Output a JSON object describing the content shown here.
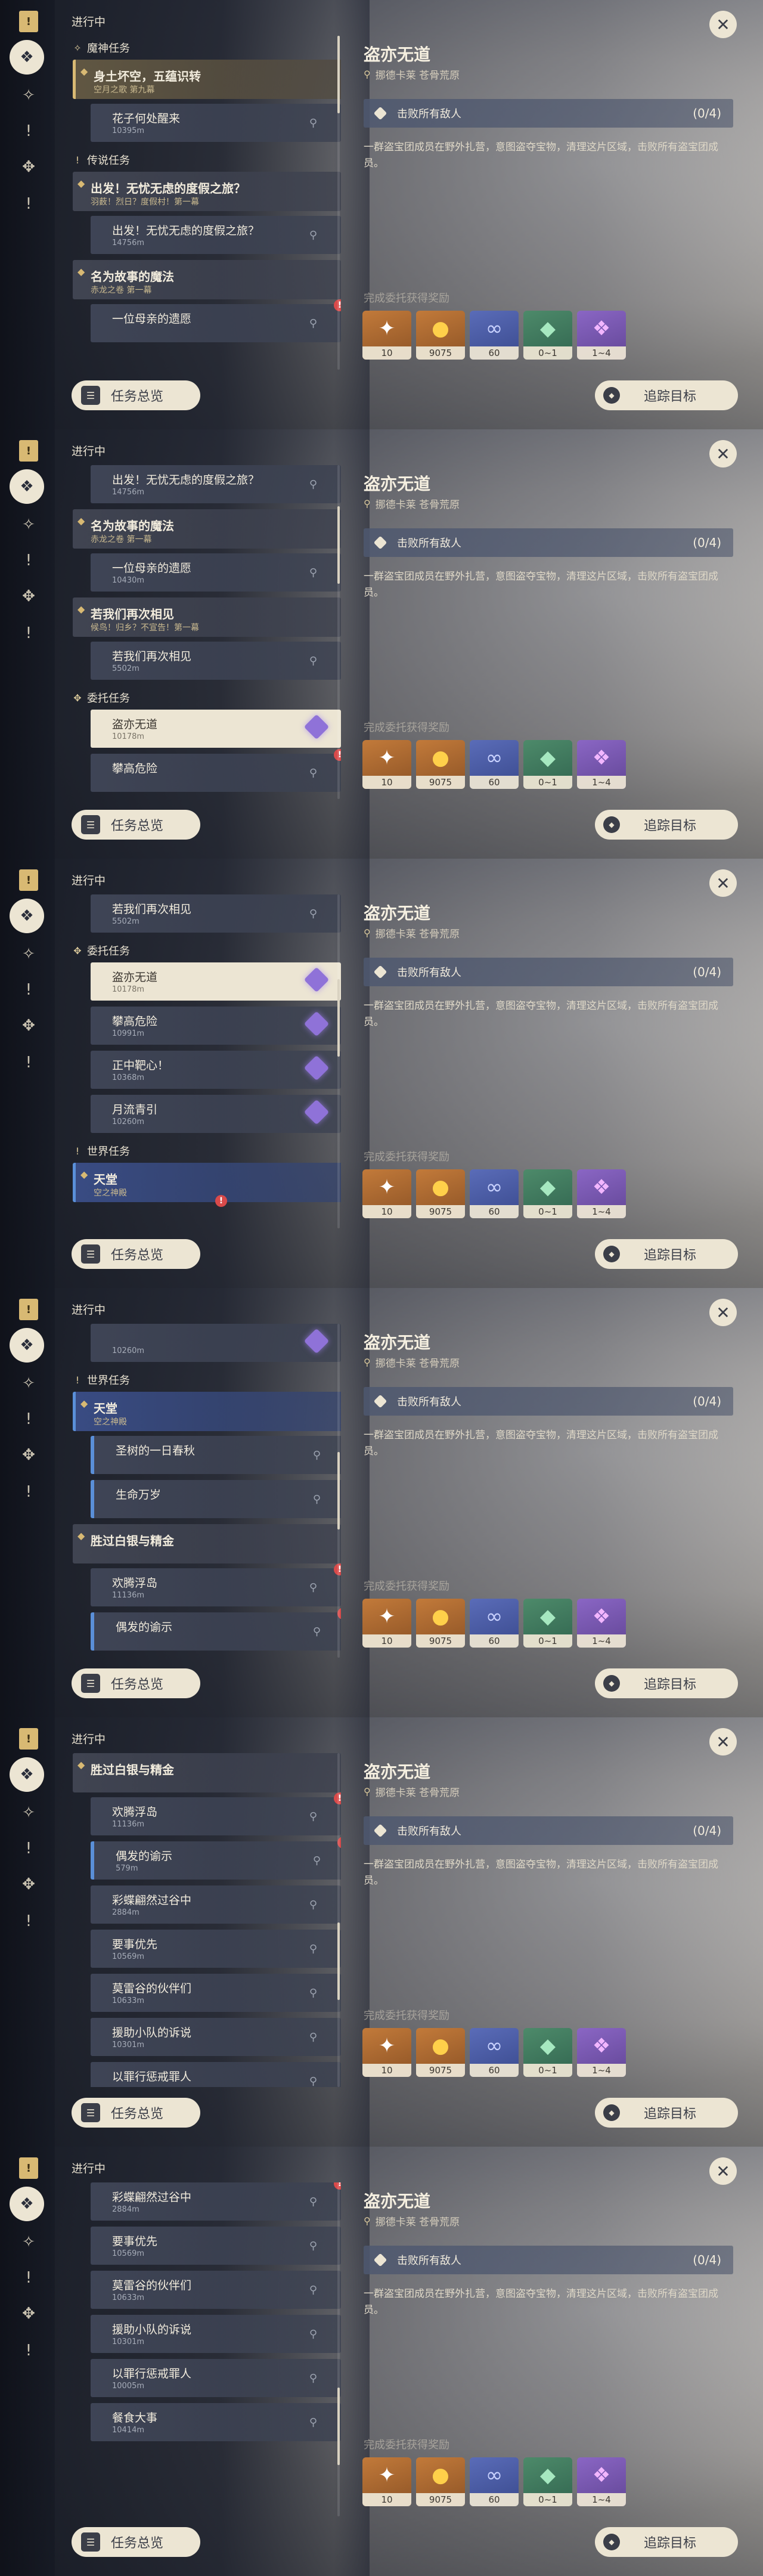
{
  "ui": {
    "header": "进行中",
    "overview_label": "任务总览",
    "close_glyph": "✕"
  },
  "detail": {
    "title": "盗亦无道",
    "location": "挪德卡莱 苍骨荒原",
    "objective": "击败所有敌人",
    "progress": "(0/4)",
    "description": "一群盗宝团成员在野外扎营，意图盗夺宝物，清理这片区域，击败所有盗宝团成员。",
    "rewards_label": "完成委托获得奖励",
    "track_label": "追踪目标",
    "rewards": [
      {
        "icon": "adventure-exp-icon",
        "glyph": "✦",
        "count": "10",
        "bg": "orange",
        "color": "white"
      },
      {
        "icon": "mora-icon",
        "glyph": "●",
        "count": "9075",
        "bg": "orange",
        "color": "gold"
      },
      {
        "icon": "companionship-exp-icon",
        "glyph": "∞",
        "count": "60",
        "bg": "blue",
        "color": "ring"
      },
      {
        "icon": "jade-icon",
        "glyph": "◆",
        "count": "0~1",
        "bg": "green",
        "color": "jade"
      },
      {
        "icon": "crystal-icon",
        "glyph": "❖",
        "count": "1~4",
        "bg": "purple",
        "color": "crystal"
      }
    ]
  },
  "frames": [
    {
      "scroll_thumb_top": 0.0,
      "active_rail": 1,
      "rows": [
        {
          "kind": "group",
          "icon": "archon-icon",
          "label": "魔神任务"
        },
        {
          "kind": "quest",
          "style": "main-hl",
          "title": "身土坏空，五蕴识转",
          "sub": "空月之歌 第九幕"
        },
        {
          "kind": "sub",
          "title": "花子何处醒来",
          "dist": "10395m"
        },
        {
          "kind": "group",
          "icon": "legend-icon",
          "label": "传说任务"
        },
        {
          "kind": "quest",
          "title": "出发！无忧无虑的度假之旅？",
          "sub": "羽薮！烈日？度假村！第一幕"
        },
        {
          "kind": "sub",
          "title": "出发！无忧无虑的度假之旅？",
          "dist": "14756m"
        },
        {
          "kind": "quest",
          "title": "名为故事的魔法",
          "sub": "赤龙之卷 第一幕"
        },
        {
          "kind": "sub",
          "title": "一位母亲的遗愿",
          "dist": "",
          "red": true
        }
      ]
    },
    {
      "scroll_thumb_top": 0.16,
      "active_rail": 1,
      "rows": [
        {
          "kind": "sub",
          "title": "出发！无忧无虑的度假之旅？",
          "dist": "14756m"
        },
        {
          "kind": "quest",
          "title": "名为故事的魔法",
          "sub": "赤龙之卷 第一幕"
        },
        {
          "kind": "sub",
          "title": "一位母亲的遗愿",
          "dist": "10430m"
        },
        {
          "kind": "quest",
          "title": "若我们再次相见",
          "sub": "候鸟！归乡？不宣告！第一幕"
        },
        {
          "kind": "sub",
          "title": "若我们再次相见",
          "dist": "5502m"
        },
        {
          "kind": "group",
          "icon": "commission-icon",
          "label": "委托任务"
        },
        {
          "kind": "sub",
          "title": "盗亦无道",
          "dist": "10178m",
          "selected": true,
          "purple": true
        },
        {
          "kind": "sub",
          "title": "攀高危险",
          "dist": "",
          "red": true
        }
      ]
    },
    {
      "scroll_thumb_top": 0.33,
      "active_rail": 1,
      "rows": [
        {
          "kind": "sub",
          "title": "若我们再次相见",
          "dist": "5502m"
        },
        {
          "kind": "group",
          "icon": "commission-icon",
          "label": "委托任务"
        },
        {
          "kind": "sub",
          "title": "盗亦无道",
          "dist": "10178m",
          "selected": true,
          "purple": true
        },
        {
          "kind": "sub",
          "title": "攀高危险",
          "dist": "10991m",
          "purple": true
        },
        {
          "kind": "sub",
          "title": "正中靶心！",
          "dist": "10368m",
          "purple": true
        },
        {
          "kind": "sub",
          "title": "月流青引",
          "dist": "10260m",
          "purple": true
        },
        {
          "kind": "group",
          "icon": "world-icon",
          "label": "世界任务"
        },
        {
          "kind": "quest",
          "style": "blue",
          "title": "天堂",
          "sub": "空之神殿",
          "red": true
        }
      ]
    },
    {
      "scroll_thumb_top": 0.5,
      "active_rail": 1,
      "rows": [
        {
          "kind": "sub",
          "title": "",
          "dist": "10260m",
          "purple": true
        },
        {
          "kind": "group",
          "icon": "world-icon",
          "label": "世界任务"
        },
        {
          "kind": "quest",
          "style": "blue",
          "title": "天堂",
          "sub": "空之神殿"
        },
        {
          "kind": "sub",
          "title": "圣树的一日春秋",
          "dist": "",
          "bluebar": true
        },
        {
          "kind": "sub",
          "title": "生命万岁",
          "dist": "",
          "bluebar": true
        },
        {
          "kind": "quest",
          "title": "胜过白银与精金",
          "sub": ""
        },
        {
          "kind": "sub",
          "title": "欢腾浮岛",
          "dist": "11136m",
          "red": true
        },
        {
          "kind": "sub",
          "title": "偶发的谕示",
          "dist": "",
          "bluebar": true,
          "red": true
        }
      ]
    },
    {
      "scroll_thumb_top": 0.66,
      "active_rail": 1,
      "rows": [
        {
          "kind": "quest",
          "title": "胜过白银与精金",
          "sub": ""
        },
        {
          "kind": "sub",
          "title": "欢腾浮岛",
          "dist": "11136m",
          "red": true
        },
        {
          "kind": "sub",
          "title": "偶发的谕示",
          "dist": "579m",
          "bluebar": true,
          "red": true
        },
        {
          "kind": "sub",
          "title": "彩蝶翩然过谷中",
          "dist": "2884m"
        },
        {
          "kind": "sub",
          "title": "要事优先",
          "dist": "10569m"
        },
        {
          "kind": "sub",
          "title": "莫雷谷的伙伴们",
          "dist": "10633m"
        },
        {
          "kind": "sub",
          "title": "援助小队的诉说",
          "dist": "10301m"
        },
        {
          "kind": "sub",
          "title": "以罪行惩戒罪人",
          "dist": ""
        }
      ]
    },
    {
      "scroll_thumb_top": 0.8,
      "active_rail": 1,
      "rows": [
        {
          "kind": "sub",
          "title": "彩蝶翩然过谷中",
          "dist": "2884m",
          "red": true
        },
        {
          "kind": "sub",
          "title": "要事优先",
          "dist": "10569m"
        },
        {
          "kind": "sub",
          "title": "莫雷谷的伙伴们",
          "dist": "10633m"
        },
        {
          "kind": "sub",
          "title": "援助小队的诉说",
          "dist": "10301m"
        },
        {
          "kind": "sub",
          "title": "以罪行惩戒罪人",
          "dist": "10005m"
        },
        {
          "kind": "sub",
          "title": "餐食大事",
          "dist": "10414m"
        }
      ]
    }
  ]
}
